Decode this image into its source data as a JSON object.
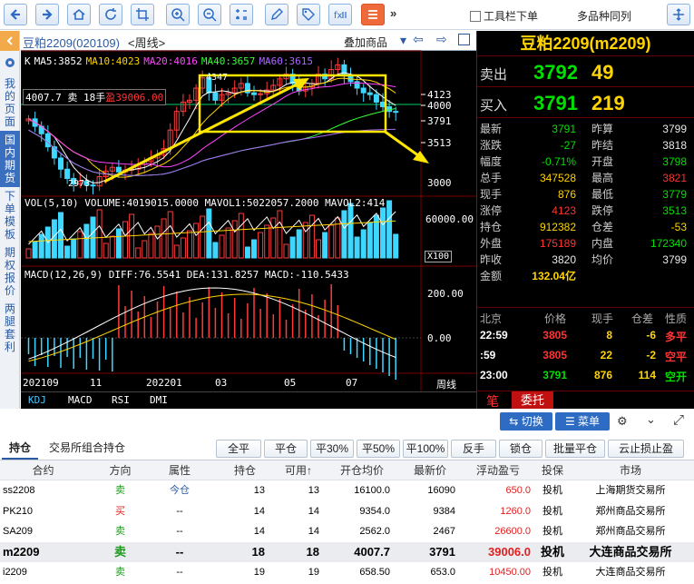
{
  "toolbar": {
    "more": "»",
    "toolbar_below": "工具栏下单",
    "multi_same": "多品种同列"
  },
  "sidebar": {
    "items": [
      "我的页面",
      "国内期货",
      "下单模板",
      "期权报价",
      "两腿套利"
    ]
  },
  "chart": {
    "title": "豆粕2209(020109)",
    "period": "<周线>",
    "overlay": "叠加商品",
    "ma_labels": [
      {
        "t": "K",
        "c": "#ffffff"
      },
      {
        "t": "MA5:3852",
        "c": "#ffffff"
      },
      {
        "t": "MA10:4023",
        "c": "#ffd400"
      },
      {
        "t": "MA20:4016",
        "c": "#ff44ff"
      },
      {
        "t": "MA40:3657",
        "c": "#33ff33"
      },
      {
        "t": "MA60:3615",
        "c": "#aa66ff"
      }
    ],
    "position_label": "4007.7 卖 18手",
    "profit_label": "盈39006.00",
    "high_mark": "4347",
    "low_mark": "2973",
    "price_ticks": [
      "4123",
      "4000",
      "3791",
      "3513",
      "3000"
    ],
    "vol_label": "VOL(5,10) VOLUME:4019015.0000 MAVOL1:5022057.2000 MAVOL2:414",
    "vol_tick": "60000.00",
    "vol_unit": "X100",
    "macd_label": "MACD(12,26,9) DIFF:76.5541 DEA:131.8257 MACD:-110.5433",
    "macd_ticks": [
      "200.00",
      "0.00"
    ],
    "x_labels": [
      "202109",
      "11",
      "202201",
      "03",
      "05",
      "07"
    ],
    "x_right": "周线",
    "ind_tabs": [
      "KDJ",
      "MACD",
      "RSI",
      "DMI"
    ]
  },
  "quote": {
    "title": "豆粕2209(m2209)",
    "sell": {
      "label": "卖出",
      "price": "3792",
      "vol": "49"
    },
    "buy": {
      "label": "买入",
      "price": "3791",
      "vol": "219"
    },
    "rows": [
      {
        "l1": "最新",
        "v1": "3791",
        "c1": "green",
        "l2": "昨算",
        "v2": "3799",
        "c2": "white"
      },
      {
        "l1": "涨跌",
        "v1": "-27",
        "c1": "green",
        "l2": "昨结",
        "v2": "3818",
        "c2": "white"
      },
      {
        "l1": "幅度",
        "v1": "-0.71%",
        "c1": "green",
        "l2": "开盘",
        "v2": "3798",
        "c2": "green"
      },
      {
        "l1": "总手",
        "v1": "347528",
        "c1": "yellow",
        "l2": "最高",
        "v2": "3821",
        "c2": "red"
      },
      {
        "l1": "现手",
        "v1": "876",
        "c1": "yellow",
        "l2": "最低",
        "v2": "3779",
        "c2": "green"
      },
      {
        "l1": "涨停",
        "v1": "4123",
        "c1": "red",
        "l2": "跌停",
        "v2": "3513",
        "c2": "green"
      },
      {
        "l1": "持仓",
        "v1": "912382",
        "c1": "yellow",
        "l2": "仓差",
        "v2": "-53",
        "c2": "yellow"
      },
      {
        "l1": "外盘",
        "v1": "175189",
        "c1": "red",
        "l2": "内盘",
        "v2": "172340",
        "c2": "green"
      },
      {
        "l1": "昨收",
        "v1": "3820",
        "c1": "white",
        "l2": "均价",
        "v2": "3799",
        "c2": "white"
      },
      {
        "l1": "金额",
        "v1": "132.04亿",
        "c1": "yellow",
        "l2": "",
        "v2": "",
        "c2": "white"
      }
    ],
    "tick_header": [
      "北京",
      "价格",
      "现手",
      "仓差",
      "性质"
    ],
    "ticks": [
      {
        "time": "22:59",
        "price": "3805",
        "vol": "8",
        "diff": "-6",
        "nature": "多平",
        "pc": "red",
        "nc": "red"
      },
      {
        "time": ":59",
        "price": "3805",
        "vol": "22",
        "diff": "-2",
        "nature": "空平",
        "pc": "red",
        "nc": "red"
      },
      {
        "time": "23:00",
        "price": "3791",
        "vol": "876",
        "diff": "114",
        "nature": "空开",
        "pc": "green",
        "nc": "green"
      }
    ],
    "bottom_tabs": [
      "笔",
      "委托"
    ]
  },
  "actions": {
    "switch": "切换",
    "menu": "菜单"
  },
  "bottom": {
    "tabs": [
      "持仓",
      "交易所组合持仓"
    ],
    "buttons": [
      "全平",
      "平仓",
      "平30%",
      "平50%",
      "平100%",
      "反手",
      "锁仓",
      "批量平仓",
      "云止损止盈"
    ],
    "columns": [
      "合约",
      "方向",
      "属性",
      "持仓",
      "可用↑",
      "开仓均价",
      "最新价",
      "浮动盈亏",
      "投保",
      "市场"
    ],
    "rows": [
      {
        "contract": "ss2208",
        "dir": "卖",
        "attr": "今仓",
        "hold": "13",
        "avail": "13",
        "open": "16100.0",
        "last": "16090",
        "pnl": "650.0",
        "hedge": "投机",
        "market": "上海期货交易所",
        "sel": false
      },
      {
        "contract": "PK210",
        "dir": "买",
        "attr": "--",
        "hold": "14",
        "avail": "14",
        "open": "9354.0",
        "last": "9384",
        "pnl": "1260.0",
        "hedge": "投机",
        "market": "郑州商品交易所",
        "sel": false
      },
      {
        "contract": "SA209",
        "dir": "卖",
        "attr": "--",
        "hold": "14",
        "avail": "14",
        "open": "2562.0",
        "last": "2467",
        "pnl": "26600.0",
        "hedge": "投机",
        "market": "郑州商品交易所",
        "sel": false
      },
      {
        "contract": "m2209",
        "dir": "卖",
        "attr": "--",
        "hold": "18",
        "avail": "18",
        "open": "4007.7",
        "last": "3791",
        "pnl": "39006.0",
        "hedge": "投机",
        "market": "大连商品交易所",
        "sel": true
      },
      {
        "contract": "i2209",
        "dir": "卖",
        "attr": "--",
        "hold": "19",
        "avail": "19",
        "open": "658.50",
        "last": "653.0",
        "pnl": "10450.00",
        "hedge": "投机",
        "market": "大连商品交易所",
        "sel": false
      }
    ]
  }
}
